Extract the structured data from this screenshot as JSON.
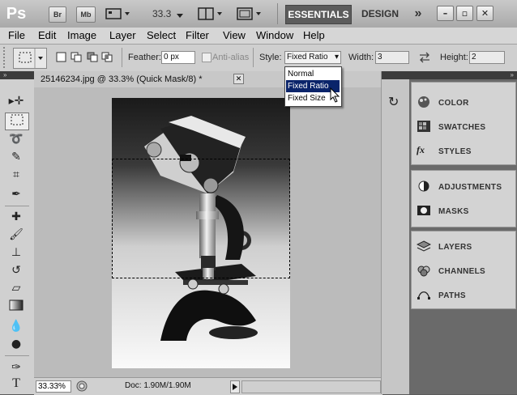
{
  "appbar": {
    "logo": "Ps",
    "bridge": "Br",
    "minibridge": "Mb",
    "zoom": "33.3",
    "workspace_essentials": "ESSENTIALS",
    "workspace_design": "DESIGN",
    "more": "»"
  },
  "menu": [
    "File",
    "Edit",
    "Image",
    "Layer",
    "Select",
    "Filter",
    "View",
    "Window",
    "Help"
  ],
  "options": {
    "feather_label": "Feather:",
    "feather_value": "0 px",
    "antialias_label": "Anti-alias",
    "style_label": "Style:",
    "style_value": "Fixed Ratio",
    "width_label": "Width:",
    "width_value": "3",
    "height_label": "Height:",
    "height_value": "2"
  },
  "style_dropdown": [
    "Normal",
    "Fixed Ratio",
    "Fixed Size"
  ],
  "document": {
    "tab_title": "25146234.jpg @ 33.3% (Quick Mask/8) *"
  },
  "status": {
    "zoom": "33.33%",
    "doc_info": "Doc: 1.90M/1.90M"
  },
  "panels": {
    "group1": [
      "COLOR",
      "SWATCHES",
      "STYLES"
    ],
    "group2": [
      "ADJUSTMENTS",
      "MASKS"
    ],
    "group3": [
      "LAYERS",
      "CHANNELS",
      "PATHS"
    ]
  },
  "colors": {
    "highlight": "#0a246a",
    "workspace_active": "#5c5c5c",
    "panel_bg": "#d3d3d3"
  }
}
